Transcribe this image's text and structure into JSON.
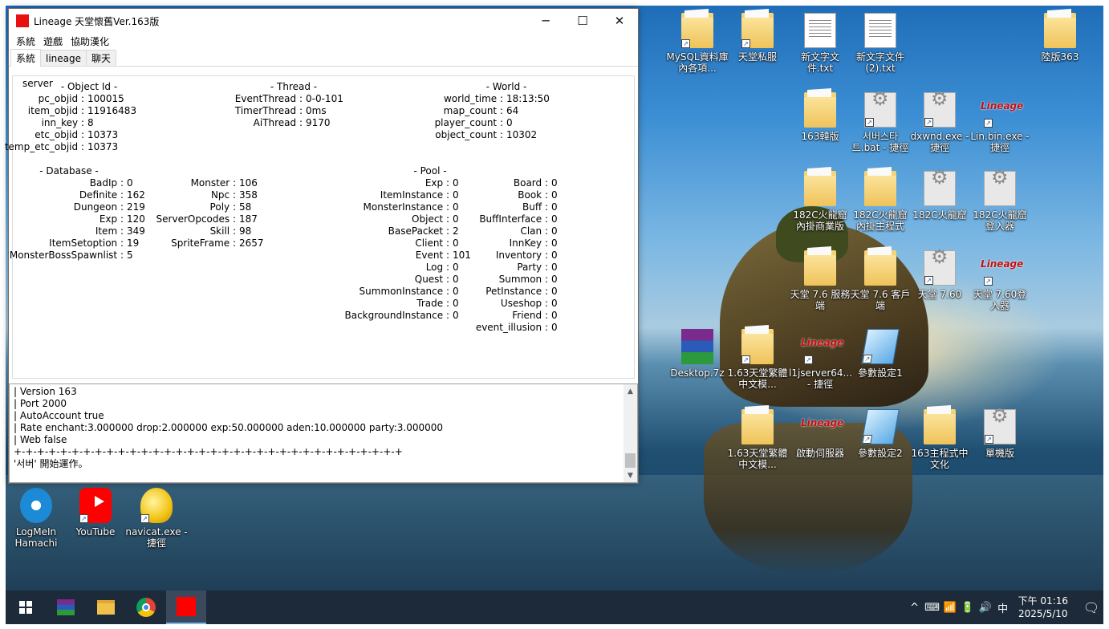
{
  "window": {
    "title": "Lineage 天堂懷舊Ver.163版",
    "min": "─",
    "max": "☐",
    "close": "✕"
  },
  "menu": [
    "系統",
    "遊戲",
    "協助漢化"
  ],
  "tabs": [
    "系統",
    "lineage",
    "聊天"
  ],
  "group_label": "server",
  "object_id": {
    "header": "- Object Id -",
    "rows": [
      [
        "pc_objid",
        "100015"
      ],
      [
        "item_objid",
        "11916483"
      ],
      [
        "inn_key",
        "8"
      ],
      [
        "etc_objid",
        "10373"
      ],
      [
        "temp_etc_objid",
        "10373"
      ]
    ]
  },
  "thread": {
    "header": "- Thread -",
    "rows": [
      [
        "EventThread",
        "0-0-101"
      ],
      [
        "TimerThread",
        "0ms"
      ],
      [
        "AiThread",
        "9170"
      ]
    ]
  },
  "world": {
    "header": "- World -",
    "rows": [
      [
        "world_time",
        "18:13:50"
      ],
      [
        "map_count",
        "64"
      ],
      [
        "player_count",
        "0"
      ],
      [
        "object_count",
        "10302"
      ]
    ]
  },
  "database": {
    "header": "- Database -",
    "col1": [
      [
        "BadIp",
        "0"
      ],
      [
        "Definite",
        "162"
      ],
      [
        "Dungeon",
        "219"
      ],
      [
        "Exp",
        "120"
      ],
      [
        "Item",
        "349"
      ],
      [
        "ItemSetoption",
        "19"
      ],
      [
        "MonsterBossSpawnlist",
        "5"
      ]
    ],
    "col2": [
      [
        "Monster",
        "106"
      ],
      [
        "Npc",
        "358"
      ],
      [
        "Poly",
        "58"
      ],
      [
        "ServerOpcodes",
        "187"
      ],
      [
        "Skill",
        "98"
      ],
      [
        "SpriteFrame",
        "2657"
      ]
    ]
  },
  "pool": {
    "header": "- Pool -",
    "col1": [
      [
        "Exp",
        "0"
      ],
      [
        "ItemInstance",
        "0"
      ],
      [
        "MonsterInstance",
        "0"
      ],
      [
        "Object",
        "0"
      ],
      [
        "BasePacket",
        "2"
      ],
      [
        "Client",
        "0"
      ],
      [
        "Event",
        "101"
      ],
      [
        "Log",
        "0"
      ],
      [
        "Quest",
        "0"
      ],
      [
        "SummonInstance",
        "0"
      ],
      [
        "Trade",
        "0"
      ],
      [
        "BackgroundInstance",
        "0"
      ]
    ],
    "col2": [
      [
        "Board",
        "0"
      ],
      [
        "Book",
        "0"
      ],
      [
        "Buff",
        "0"
      ],
      [
        "BuffInterface",
        "0"
      ],
      [
        "Clan",
        "0"
      ],
      [
        "InnKey",
        "0"
      ],
      [
        "Inventory",
        "0"
      ],
      [
        "Party",
        "0"
      ],
      [
        "Summon",
        "0"
      ],
      [
        "PetInstance",
        "0"
      ],
      [
        "Useshop",
        "0"
      ],
      [
        "Friend",
        "0"
      ],
      [
        "event_illusion",
        "0"
      ]
    ]
  },
  "console": [
    "| Version 163",
    "| Port 2000",
    "| AutoAccount true",
    "| Rate enchant:3.000000 drop:2.000000 exp:50.000000 aden:10.000000 party:3.000000",
    "| Web false",
    "+-+-+-+-+-+-+-+-+-+-+-+-+-+-+-+-+-+-+-+-+-+-+-+-+-+-+-+-+-+-+-+-+-+",
    "'서버' 開始運作。"
  ],
  "desktop_icons": [
    {
      "label": "MySQL資料庫內各項...",
      "type": "folder",
      "shortcut": true
    },
    {
      "label": "天堂私服",
      "type": "folder",
      "shortcut": true
    },
    {
      "label": "新文字文件.txt",
      "type": "doc",
      "shortcut": false
    },
    {
      "label": "新文字文件 (2).txt",
      "type": "doc",
      "shortcut": false
    },
    {
      "label": "陸版363",
      "type": "folder",
      "shortcut": false
    },
    {
      "label": "163韓版",
      "type": "folder",
      "shortcut": false
    },
    {
      "label": "서버스타트.bat - 捷徑",
      "type": "gear",
      "shortcut": true
    },
    {
      "label": "dxwnd.exe - 捷徑",
      "type": "gear",
      "shortcut": true
    },
    {
      "label": "Lin.bin.exe - 捷徑",
      "type": "lineage",
      "shortcut": true
    },
    {
      "label": "182C火龍窟內掛商業版",
      "type": "folder",
      "shortcut": false
    },
    {
      "label": "182C火龍窟內掛主程式",
      "type": "folder",
      "shortcut": false
    },
    {
      "label": "182C火龍窟",
      "type": "gear",
      "shortcut": false
    },
    {
      "label": "182C火龍窟登入器",
      "type": "gear",
      "shortcut": false
    },
    {
      "label": "天堂 7.6 服務端",
      "type": "folder",
      "shortcut": false
    },
    {
      "label": "天堂 7.6 客戶端",
      "type": "folder",
      "shortcut": false
    },
    {
      "label": "天堂 7.60",
      "type": "gear",
      "shortcut": true
    },
    {
      "label": "天堂 7.60登入器",
      "type": "lineage",
      "shortcut": true
    },
    {
      "label": "Desktop.7z",
      "type": "rar",
      "shortcut": false
    },
    {
      "label": "1.63天堂繁體中文模...",
      "type": "folder",
      "shortcut": true
    },
    {
      "label": "l1jserver64... - 捷徑",
      "type": "lineage",
      "shortcut": true
    },
    {
      "label": "參數設定1",
      "type": "note",
      "shortcut": true
    },
    {
      "label": "1.63天堂繁體中文模...",
      "type": "folder",
      "shortcut": false
    },
    {
      "label": "啟動伺服器",
      "type": "lineage",
      "shortcut": false
    },
    {
      "label": "參數設定2",
      "type": "note",
      "shortcut": true
    },
    {
      "label": "163主程式中文化",
      "type": "folder",
      "shortcut": false
    },
    {
      "label": "單機版",
      "type": "gear",
      "shortcut": true
    },
    {
      "label": "LogMeIn Hamachi",
      "type": "logme",
      "shortcut": false
    },
    {
      "label": "YouTube",
      "type": "yt",
      "shortcut": true
    },
    {
      "label": "navicat.exe - 捷徑",
      "type": "navi",
      "shortcut": true
    }
  ],
  "taskbar": {
    "apps": [
      "start",
      "winrar",
      "file-explorer",
      "chrome",
      "lineage-server"
    ]
  },
  "tray": {
    "icons": [
      "^",
      "⌨",
      "📶",
      "🔋",
      "🔊"
    ],
    "ime": "中",
    "time": "下午 01:16",
    "date": "2025/5/10",
    "notifications": "🗨"
  }
}
